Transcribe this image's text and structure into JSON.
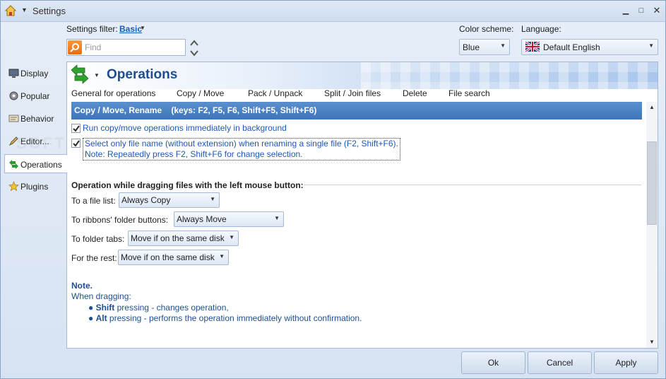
{
  "window": {
    "title": "Settings"
  },
  "filter": {
    "label": "Settings filter:",
    "value": "Basic",
    "search_placeholder": "Find"
  },
  "color_scheme": {
    "label": "Color scheme:",
    "value": "Blue"
  },
  "language": {
    "label": "Language:",
    "value": "Default English"
  },
  "sidebar": {
    "items": [
      {
        "label": "Display"
      },
      {
        "label": "Popular"
      },
      {
        "label": "Behavior"
      },
      {
        "label": "Editor..."
      },
      {
        "label": "Operations"
      },
      {
        "label": "Plugins"
      }
    ],
    "active": "Operations"
  },
  "panel": {
    "title": "Operations",
    "tabs": [
      "General for operations",
      "Copy / Move",
      "Pack / Unpack",
      "Split / Join files",
      "Delete",
      "File search"
    ],
    "section_title": "Copy / Move, Rename    (keys: F2, F5, F6, Shift+F5, Shift+F6)",
    "checkboxes": [
      {
        "label": "Run copy/move operations immediately in background",
        "checked": true
      },
      {
        "label": "Select only file name (without extension) when renaming a single file (F2, Shift+F6).",
        "label2": "Note: Repeatedly press F2, Shift+F6 for change selection.",
        "checked": true
      }
    ],
    "drag_group": {
      "heading": "Operation while dragging files with the left mouse button:",
      "rows": [
        {
          "label": "To a file list:",
          "value": "Always Copy"
        },
        {
          "label": "To ribbons' folder buttons:",
          "value": "Always Move"
        },
        {
          "label": "To folder tabs:",
          "value": "Move if on the same disk"
        },
        {
          "label": "For the rest:",
          "value": "Move if on the same disk"
        }
      ]
    },
    "note": {
      "title": "Note.",
      "line": "When dragging:",
      "bullets": [
        {
          "key": "Shift",
          "text": " pressing - changes operation,"
        },
        {
          "key": "Alt",
          "text": " pressing - performs the operation immediately without confirmation."
        }
      ]
    }
  },
  "watermark": "SOFTP",
  "buttons": {
    "ok": "Ok",
    "cancel": "Cancel",
    "apply": "Apply"
  },
  "colors": {
    "accent": "#3f74b8",
    "title": "#1d4f8f",
    "link": "#1a5bb8",
    "checkbox_text": "#1f57b5"
  },
  "icons": [
    "home-icon",
    "search-icon",
    "up-down-arrows-icon",
    "uk-flag-icon",
    "display-icon",
    "popular-icon",
    "behavior-icon",
    "editor-icon",
    "operations-icon",
    "plugins-icon"
  ]
}
